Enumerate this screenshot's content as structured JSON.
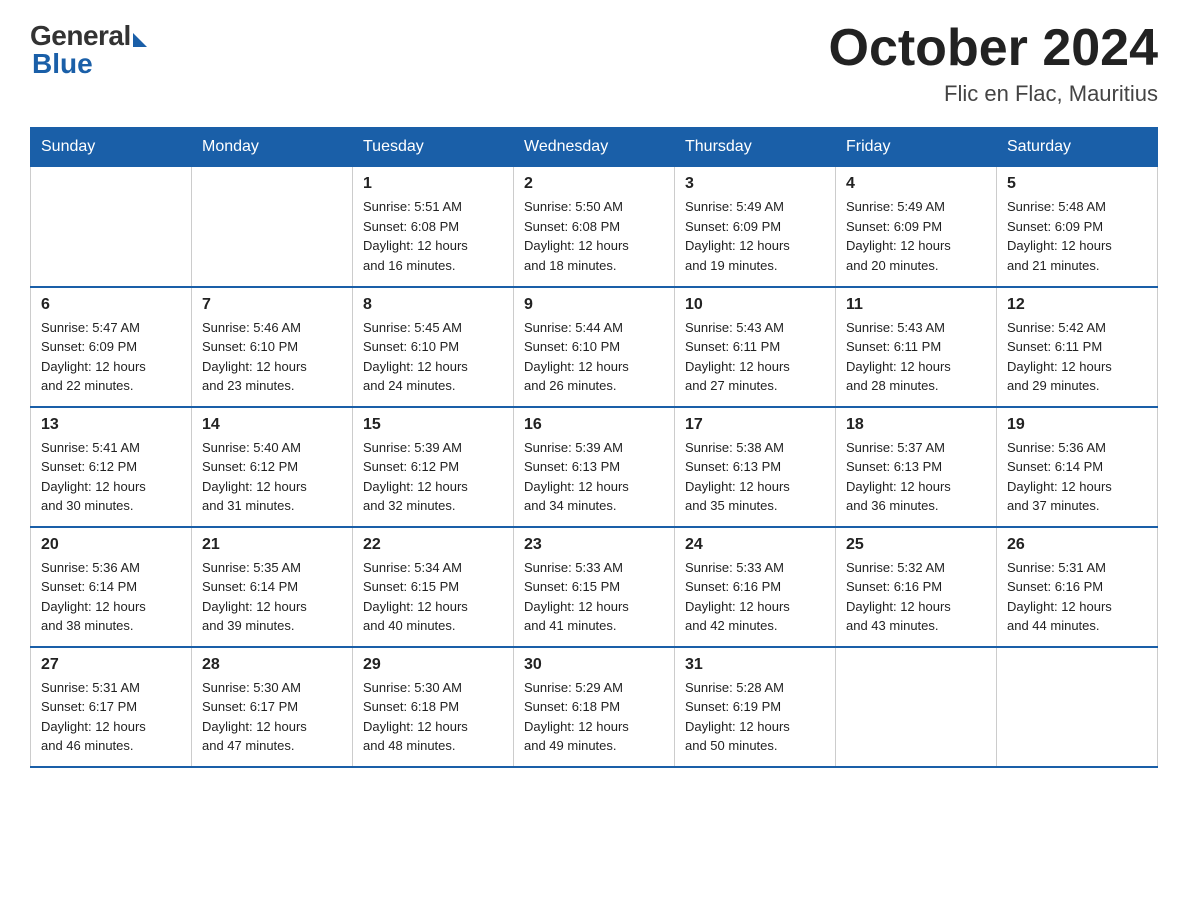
{
  "logo": {
    "general": "General",
    "blue": "Blue"
  },
  "title": {
    "month_year": "October 2024",
    "location": "Flic en Flac, Mauritius"
  },
  "weekdays": [
    "Sunday",
    "Monday",
    "Tuesday",
    "Wednesday",
    "Thursday",
    "Friday",
    "Saturday"
  ],
  "weeks": [
    [
      {
        "day": "",
        "info": ""
      },
      {
        "day": "",
        "info": ""
      },
      {
        "day": "1",
        "info": "Sunrise: 5:51 AM\nSunset: 6:08 PM\nDaylight: 12 hours\nand 16 minutes."
      },
      {
        "day": "2",
        "info": "Sunrise: 5:50 AM\nSunset: 6:08 PM\nDaylight: 12 hours\nand 18 minutes."
      },
      {
        "day": "3",
        "info": "Sunrise: 5:49 AM\nSunset: 6:09 PM\nDaylight: 12 hours\nand 19 minutes."
      },
      {
        "day": "4",
        "info": "Sunrise: 5:49 AM\nSunset: 6:09 PM\nDaylight: 12 hours\nand 20 minutes."
      },
      {
        "day": "5",
        "info": "Sunrise: 5:48 AM\nSunset: 6:09 PM\nDaylight: 12 hours\nand 21 minutes."
      }
    ],
    [
      {
        "day": "6",
        "info": "Sunrise: 5:47 AM\nSunset: 6:09 PM\nDaylight: 12 hours\nand 22 minutes."
      },
      {
        "day": "7",
        "info": "Sunrise: 5:46 AM\nSunset: 6:10 PM\nDaylight: 12 hours\nand 23 minutes."
      },
      {
        "day": "8",
        "info": "Sunrise: 5:45 AM\nSunset: 6:10 PM\nDaylight: 12 hours\nand 24 minutes."
      },
      {
        "day": "9",
        "info": "Sunrise: 5:44 AM\nSunset: 6:10 PM\nDaylight: 12 hours\nand 26 minutes."
      },
      {
        "day": "10",
        "info": "Sunrise: 5:43 AM\nSunset: 6:11 PM\nDaylight: 12 hours\nand 27 minutes."
      },
      {
        "day": "11",
        "info": "Sunrise: 5:43 AM\nSunset: 6:11 PM\nDaylight: 12 hours\nand 28 minutes."
      },
      {
        "day": "12",
        "info": "Sunrise: 5:42 AM\nSunset: 6:11 PM\nDaylight: 12 hours\nand 29 minutes."
      }
    ],
    [
      {
        "day": "13",
        "info": "Sunrise: 5:41 AM\nSunset: 6:12 PM\nDaylight: 12 hours\nand 30 minutes."
      },
      {
        "day": "14",
        "info": "Sunrise: 5:40 AM\nSunset: 6:12 PM\nDaylight: 12 hours\nand 31 minutes."
      },
      {
        "day": "15",
        "info": "Sunrise: 5:39 AM\nSunset: 6:12 PM\nDaylight: 12 hours\nand 32 minutes."
      },
      {
        "day": "16",
        "info": "Sunrise: 5:39 AM\nSunset: 6:13 PM\nDaylight: 12 hours\nand 34 minutes."
      },
      {
        "day": "17",
        "info": "Sunrise: 5:38 AM\nSunset: 6:13 PM\nDaylight: 12 hours\nand 35 minutes."
      },
      {
        "day": "18",
        "info": "Sunrise: 5:37 AM\nSunset: 6:13 PM\nDaylight: 12 hours\nand 36 minutes."
      },
      {
        "day": "19",
        "info": "Sunrise: 5:36 AM\nSunset: 6:14 PM\nDaylight: 12 hours\nand 37 minutes."
      }
    ],
    [
      {
        "day": "20",
        "info": "Sunrise: 5:36 AM\nSunset: 6:14 PM\nDaylight: 12 hours\nand 38 minutes."
      },
      {
        "day": "21",
        "info": "Sunrise: 5:35 AM\nSunset: 6:14 PM\nDaylight: 12 hours\nand 39 minutes."
      },
      {
        "day": "22",
        "info": "Sunrise: 5:34 AM\nSunset: 6:15 PM\nDaylight: 12 hours\nand 40 minutes."
      },
      {
        "day": "23",
        "info": "Sunrise: 5:33 AM\nSunset: 6:15 PM\nDaylight: 12 hours\nand 41 minutes."
      },
      {
        "day": "24",
        "info": "Sunrise: 5:33 AM\nSunset: 6:16 PM\nDaylight: 12 hours\nand 42 minutes."
      },
      {
        "day": "25",
        "info": "Sunrise: 5:32 AM\nSunset: 6:16 PM\nDaylight: 12 hours\nand 43 minutes."
      },
      {
        "day": "26",
        "info": "Sunrise: 5:31 AM\nSunset: 6:16 PM\nDaylight: 12 hours\nand 44 minutes."
      }
    ],
    [
      {
        "day": "27",
        "info": "Sunrise: 5:31 AM\nSunset: 6:17 PM\nDaylight: 12 hours\nand 46 minutes."
      },
      {
        "day": "28",
        "info": "Sunrise: 5:30 AM\nSunset: 6:17 PM\nDaylight: 12 hours\nand 47 minutes."
      },
      {
        "day": "29",
        "info": "Sunrise: 5:30 AM\nSunset: 6:18 PM\nDaylight: 12 hours\nand 48 minutes."
      },
      {
        "day": "30",
        "info": "Sunrise: 5:29 AM\nSunset: 6:18 PM\nDaylight: 12 hours\nand 49 minutes."
      },
      {
        "day": "31",
        "info": "Sunrise: 5:28 AM\nSunset: 6:19 PM\nDaylight: 12 hours\nand 50 minutes."
      },
      {
        "day": "",
        "info": ""
      },
      {
        "day": "",
        "info": ""
      }
    ]
  ]
}
